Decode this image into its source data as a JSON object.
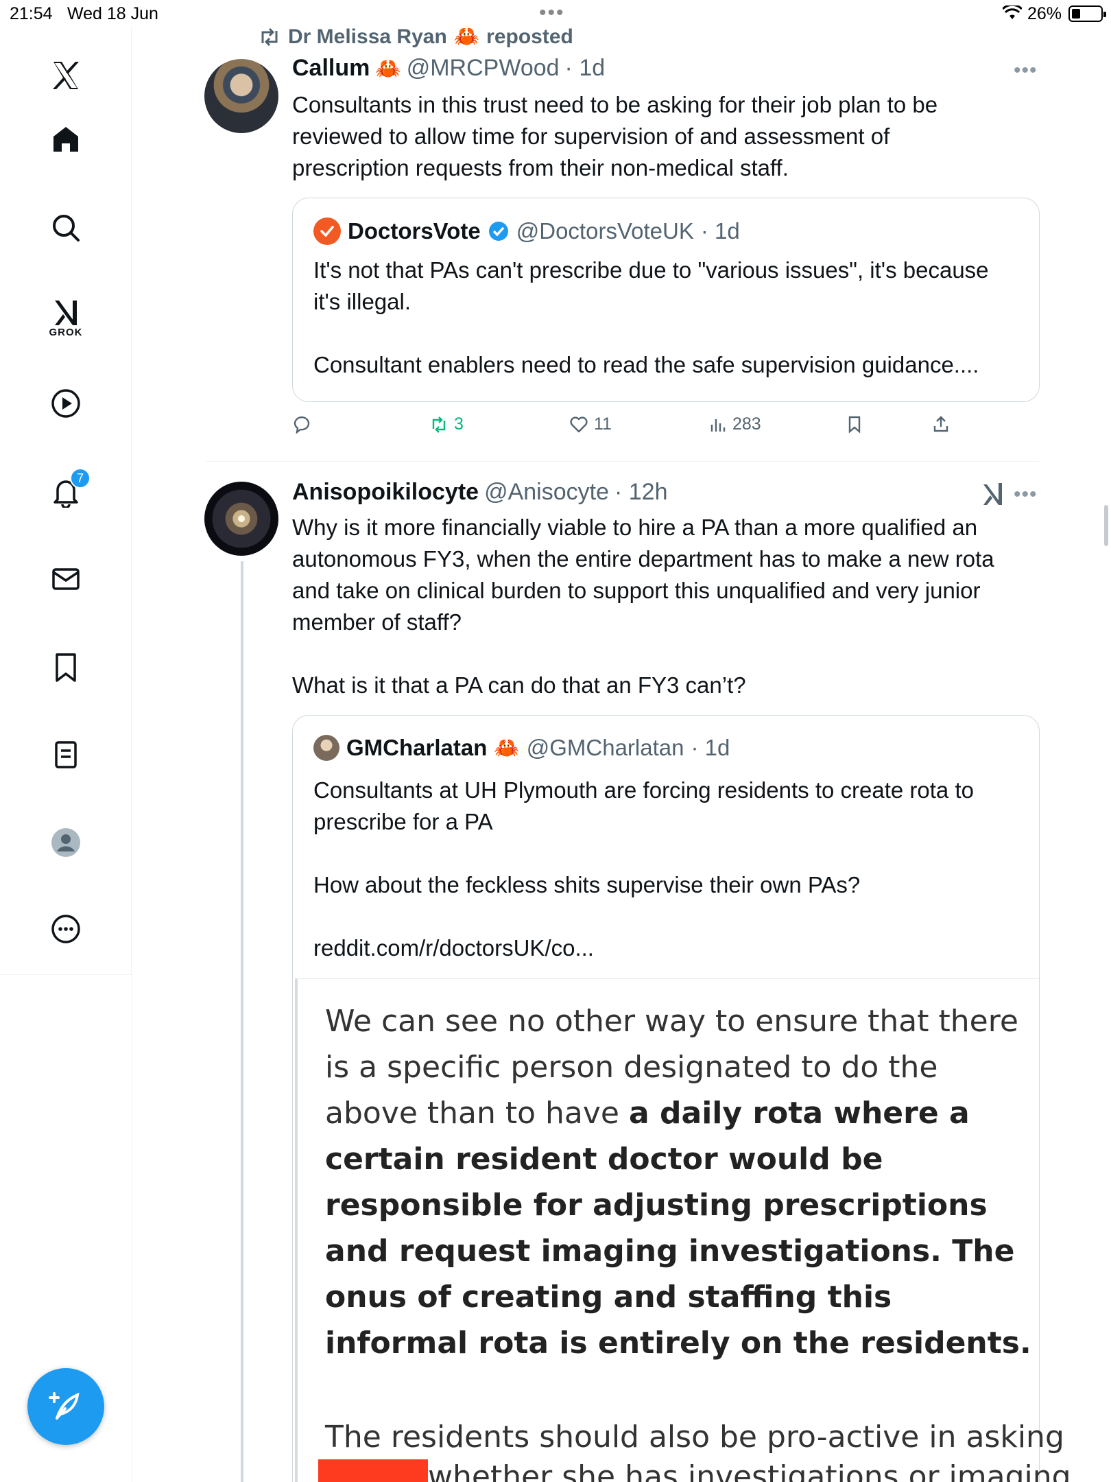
{
  "status_bar": {
    "time": "21:54",
    "date": "Wed 18 Jun",
    "battery": "26%"
  },
  "sidebar": {
    "grok_label": "GROK",
    "notification_count": "7"
  },
  "tweet1": {
    "repost_by": "Dr Melissa Ryan",
    "repost_suffix": "reposted",
    "name": "Callum",
    "handle": "@MRCPWood",
    "time": "· 1d",
    "text": "Consultants in this trust need to be asking for their job plan to be\nreviewed to allow time for supervision of and assessment of\nprescription requests from their non-medical staff.",
    "quote": {
      "name": "DoctorsVote",
      "handle": "@DoctorsVoteUK",
      "time": "· 1d",
      "text": "It's not that PAs can't prescribe due to \"various issues\", it's because\nit's illegal.\n\nConsultant enablers need to read the safe supervision guidance...."
    },
    "stats": {
      "reposts": "3",
      "likes": "11",
      "views": "283"
    }
  },
  "tweet2": {
    "name": "Anisopoikilocyte",
    "handle": "@Anisocyte",
    "time": "· 12h",
    "text": "Why is it more financially viable to hire a PA than a more qualified an\nautonomous FY3, when the entire department has to make a new rota\nand take on clinical burden to support this unqualified and very junior\nmember of staff?\n\nWhat is it that a PA can do that an FY3 can’t?",
    "quote": {
      "name": "GMCharlatan",
      "handle": "@GMCharlatan",
      "time": "· 1d",
      "text": "Consultants at UH Plymouth are forcing residents to create rota to\nprescribe for a PA\n\nHow about the feckless shits supervise their own PAs?\n\nreddit.com/r/doctorsUK/co...",
      "image_text_intro": "We can see no other way to ensure that there is a specific person designated to do the above than to have",
      "image_text_bold": "a daily rota where a certain resident doctor would be responsible for adjusting prescriptions and request imaging investigations. The onus of creating and staffing this informal rota is entirely on the residents.",
      "image_text_2": "The residents should also be pro-active in asking",
      "image_text_3": "whether she has investigations or imaging"
    }
  },
  "colors": {
    "accent": "#1d9bf0",
    "repost_green": "#00ba7c",
    "muted": "#536471",
    "doctorsvote_orange": "#f15a22",
    "redaction": "#ff3b1f"
  }
}
